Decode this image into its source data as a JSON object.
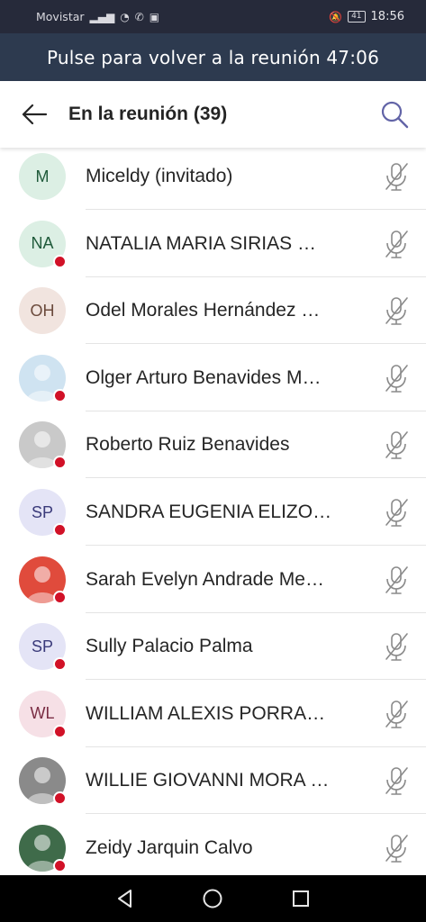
{
  "status_bar": {
    "carrier": "Movistar",
    "battery": "41",
    "time": "18:56"
  },
  "banner": {
    "text": "Pulse para volver a la reunión 47:06"
  },
  "header": {
    "title": "En la reunión (39)"
  },
  "participants": [
    {
      "initials": "M",
      "name": "Miceldy (invitado)",
      "avatar_bg": "#dcefe4",
      "avatar_fg": "#1f5a3a",
      "photo": false,
      "presence_dot": false
    },
    {
      "initials": "NA",
      "name": "NATALIA MARIA SIRIAS …",
      "avatar_bg": "#dcefe4",
      "avatar_fg": "#1f5a3a",
      "photo": false,
      "presence_dot": true
    },
    {
      "initials": "OH",
      "name": "Odel Morales Hernández  …",
      "avatar_bg": "#f1e4df",
      "avatar_fg": "#6b4a3c",
      "photo": false,
      "presence_dot": false
    },
    {
      "initials": "",
      "name": "Olger Arturo Benavides M…",
      "avatar_bg": "#cfe3f1",
      "avatar_fg": "#2a4b6b",
      "photo": true,
      "presence_dot": true
    },
    {
      "initials": "",
      "name": "Roberto Ruiz Benavides",
      "avatar_bg": "#c9c9c9",
      "avatar_fg": "#444444",
      "photo": true,
      "presence_dot": true
    },
    {
      "initials": "SP",
      "name": "SANDRA EUGENIA ELIZO…",
      "avatar_bg": "#e4e4f6",
      "avatar_fg": "#3a3a7a",
      "photo": false,
      "presence_dot": true
    },
    {
      "initials": "",
      "name": "Sarah Evelyn Andrade Me…",
      "avatar_bg": "#e04b3c",
      "avatar_fg": "#ffffff",
      "photo": true,
      "presence_dot": true
    },
    {
      "initials": "SP",
      "name": "Sully Palacio Palma",
      "avatar_bg": "#e4e4f6",
      "avatar_fg": "#3a3a7a",
      "photo": false,
      "presence_dot": true
    },
    {
      "initials": "WL",
      "name": "WILLIAM ALEXIS PORRA…",
      "avatar_bg": "#f6e0e6",
      "avatar_fg": "#7a2d44",
      "photo": false,
      "presence_dot": true
    },
    {
      "initials": "",
      "name": "WILLIE GIOVANNI MORA …",
      "avatar_bg": "#8a8a8a",
      "avatar_fg": "#ffffff",
      "photo": true,
      "presence_dot": true
    },
    {
      "initials": "",
      "name": "Zeidy Jarquin Calvo",
      "avatar_bg": "#3f6b4a",
      "avatar_fg": "#ffffff",
      "photo": true,
      "presence_dot": true
    }
  ],
  "icons": {
    "back": "arrow-left-icon",
    "search": "search-icon",
    "mic": "mic-off-icon",
    "nav_back": "triangle-back-icon",
    "nav_home": "circle-home-icon",
    "nav_recent": "square-recent-icon"
  },
  "colors": {
    "banner_bg": "#2d3a4f",
    "accent": "#6264a7",
    "presence_busy": "#d11127"
  }
}
